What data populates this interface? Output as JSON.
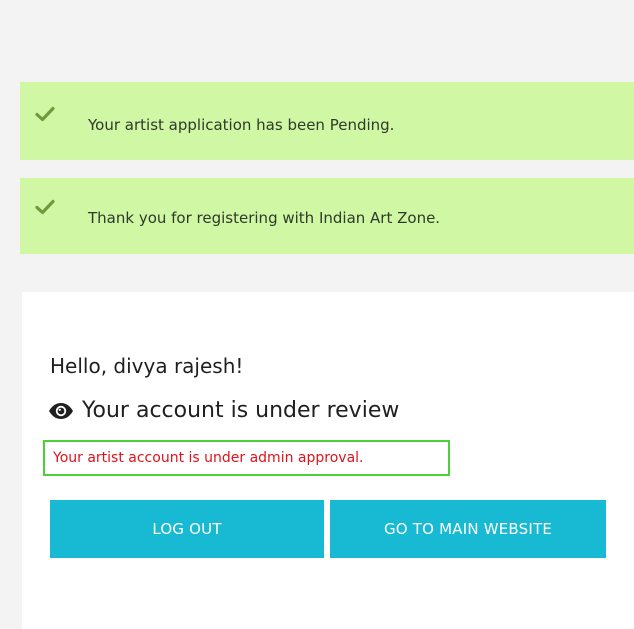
{
  "notices": [
    {
      "icon": "check-icon",
      "text": "Your artist application has been Pending."
    },
    {
      "icon": "check-icon",
      "text": "Thank you for registering with Indian Art Zone."
    }
  ],
  "account": {
    "greeting": "Hello, divya rajesh!",
    "review_icon": "eye-icon",
    "review_heading": "Your account is under review",
    "approval_message": "Your artist account is under admin approval."
  },
  "buttons": {
    "logout_label": "LOG OUT",
    "main_website_label": "GO TO MAIN WEBSITE"
  },
  "colors": {
    "notice_bg": "#cff7a4",
    "check": "#6f9a3c",
    "approval_text": "#e0121b",
    "highlight_border": "#4fd03a",
    "button_bg": "#18b9d3"
  }
}
